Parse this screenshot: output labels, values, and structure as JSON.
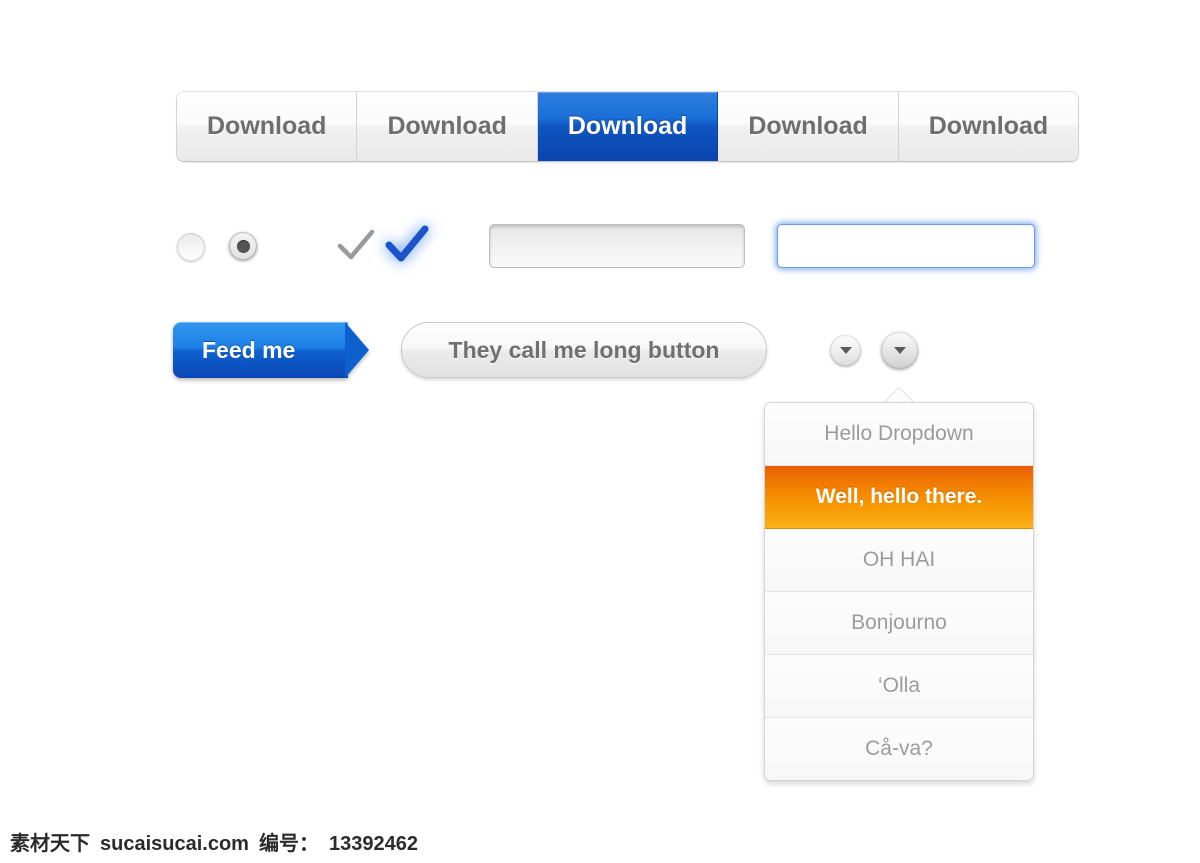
{
  "button_group": {
    "name": "segmented-download-buttons",
    "buttons": [
      {
        "label": "Download",
        "state": "normal"
      },
      {
        "label": "Download",
        "state": "normal"
      },
      {
        "label": "Download",
        "state": "active"
      },
      {
        "label": "Download",
        "state": "normal"
      },
      {
        "label": "Download",
        "state": "normal"
      }
    ],
    "active_index": 2,
    "active_color": "#0f55c0",
    "normal_text_color": "#6e6e6e"
  },
  "controls_row": {
    "radio_unselected": {
      "icon": "radio-unchecked-icon",
      "checked": false
    },
    "radio_selected": {
      "icon": "radio-checked-icon",
      "checked": true
    },
    "check_gray": {
      "icon": "checkmark-icon",
      "color": "#9a9a9a",
      "state": "normal"
    },
    "check_blue": {
      "icon": "checkmark-icon",
      "color": "#1a54c8",
      "state": "active-glow"
    },
    "text_input_default": {
      "value": "",
      "placeholder": ""
    },
    "text_input_focused": {
      "value": "",
      "placeholder": "",
      "focus_color": "#6f9ddd"
    }
  },
  "actions_row": {
    "feed_button": {
      "label": "Feed me",
      "color": "#0f60cf",
      "shape": "arrow-tag"
    },
    "long_button": {
      "label": "They call me long button",
      "shape": "pill"
    },
    "toggle_small": {
      "icon": "chevron-down-icon",
      "size": "small"
    },
    "toggle_large": {
      "icon": "chevron-down-icon",
      "size": "large",
      "state": "pressed"
    }
  },
  "dropdown": {
    "open": true,
    "highlight_color": "#f07800",
    "items": [
      {
        "label": "Hello Dropdown",
        "highlighted": false
      },
      {
        "label": "Well, hello there.",
        "highlighted": true
      },
      {
        "label": "OH HAI",
        "highlighted": false
      },
      {
        "label": "Bonjourno",
        "highlighted": false
      },
      {
        "label": "‘Olla",
        "highlighted": false
      },
      {
        "label": "Cå-va?",
        "highlighted": false
      }
    ]
  },
  "watermark": {
    "site_cn": "素材天下",
    "site_url": "sucaisucai.com",
    "id_label": "编号：",
    "id_value": "13392462"
  }
}
